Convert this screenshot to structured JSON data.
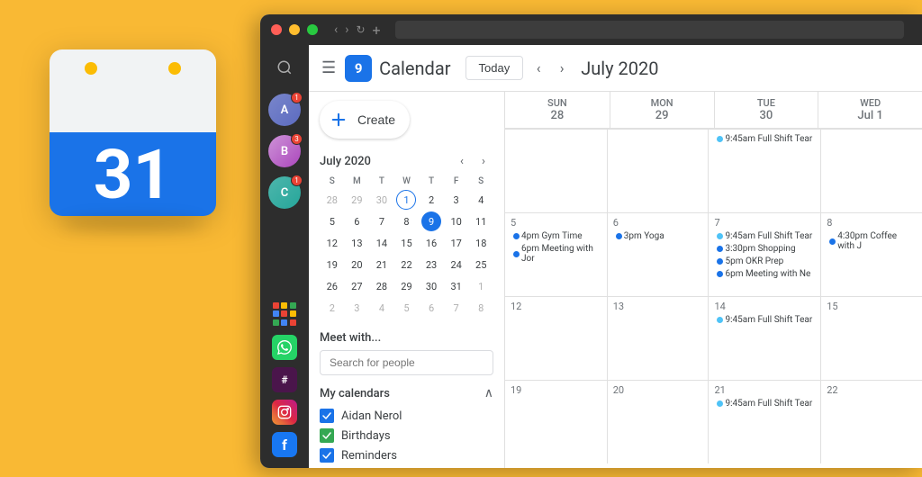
{
  "background": "#F9B934",
  "app_icon": {
    "number": "31",
    "dot1_color": "#FBBC04",
    "dot2_color": "#FBBC04"
  },
  "browser": {
    "traffic_lights": [
      "#FF5F57",
      "#FFBD2E",
      "#28C940"
    ]
  },
  "sidebar": {
    "search_icon": "🔍",
    "avatars": [
      {
        "color": "#5c6bc0",
        "initials": "A",
        "badge": "1"
      },
      {
        "color": "#ab47bc",
        "initials": "B",
        "badge": "3"
      },
      {
        "color": "#26a69a",
        "initials": "C",
        "badge": "1"
      }
    ],
    "app_icons": [
      "apps",
      "slack",
      "whatsapp",
      "instagram",
      "facebook"
    ]
  },
  "topbar": {
    "hamburger": "☰",
    "logo_number": "9",
    "title": "Calendar",
    "today_btn": "Today",
    "nav_prev": "‹",
    "nav_next": "›",
    "month_year": "July 2020"
  },
  "sidebar_content": {
    "create_btn": "Create",
    "mini_calendar": {
      "title": "July 2020",
      "nav_prev": "‹",
      "nav_next": "›",
      "weekdays": [
        "S",
        "M",
        "T",
        "W",
        "T",
        "F",
        "S"
      ],
      "weeks": [
        [
          "28",
          "29",
          "30",
          "1",
          "2",
          "3",
          "4"
        ],
        [
          "5",
          "6",
          "7",
          "8",
          "9",
          "10",
          "11"
        ],
        [
          "12",
          "13",
          "14",
          "15",
          "16",
          "17",
          "18"
        ],
        [
          "19",
          "20",
          "21",
          "22",
          "23",
          "24",
          "25"
        ],
        [
          "26",
          "27",
          "28",
          "29",
          "30",
          "31",
          "1"
        ],
        [
          "2",
          "3",
          "4",
          "5",
          "6",
          "7",
          "8"
        ]
      ],
      "other_month_dates": [
        "28",
        "29",
        "30",
        "1",
        "2",
        "3",
        "4",
        "26",
        "27",
        "28",
        "29",
        "30",
        "31",
        "1",
        "2",
        "3",
        "4",
        "5",
        "6",
        "7",
        "8"
      ],
      "today": "9",
      "first_day_index": 3
    },
    "meet_section": {
      "title": "Meet with...",
      "placeholder": "Search for people"
    },
    "my_calendars": {
      "title": "My calendars",
      "chevron": "∧",
      "items": [
        {
          "label": "Aidan Nerol",
          "color": "#1a73e8",
          "checked": true
        },
        {
          "label": "Birthdays",
          "color": "#34a853",
          "checked": true
        },
        {
          "label": "Reminders",
          "color": "#1a73e8",
          "checked": true
        }
      ]
    }
  },
  "calendar_grid": {
    "headers": [
      {
        "day": "SUN",
        "date": "28"
      },
      {
        "day": "MON",
        "date": "29"
      },
      {
        "day": "TUE",
        "date": "30"
      },
      {
        "day": "WED",
        "date": "Jul 1"
      }
    ],
    "rows": [
      {
        "cells": [
          {
            "date": "28",
            "events": []
          },
          {
            "date": "29",
            "events": []
          },
          {
            "date": "30",
            "events": [
              {
                "time": "9:45am",
                "title": "Full Shift Tear",
                "color": "light-blue"
              }
            ]
          },
          {
            "date": "Jul 1",
            "events": []
          }
        ]
      },
      {
        "cells": [
          {
            "date": "5",
            "events": [
              {
                "time": "4pm",
                "title": "Gym Time",
                "color": "blue"
              },
              {
                "time": "6pm",
                "title": "Meeting with Jor",
                "color": "blue"
              }
            ]
          },
          {
            "date": "6",
            "events": [
              {
                "time": "3pm",
                "title": "Yoga",
                "color": "blue"
              }
            ]
          },
          {
            "date": "7",
            "events": [
              {
                "time": "9:45am",
                "title": "Full Shift Tear",
                "color": "light-blue"
              },
              {
                "time": "3:30pm",
                "title": "Shopping",
                "color": "blue"
              },
              {
                "time": "5pm",
                "title": "OKR Prep",
                "color": "blue"
              },
              {
                "time": "6pm",
                "title": "Meeting with Ne",
                "color": "blue"
              }
            ]
          },
          {
            "date": "8",
            "events": [
              {
                "time": "4:30pm",
                "title": "Coffee with J",
                "color": "blue"
              }
            ]
          }
        ]
      },
      {
        "cells": [
          {
            "date": "12",
            "events": []
          },
          {
            "date": "13",
            "events": []
          },
          {
            "date": "14",
            "events": [
              {
                "time": "9:45am",
                "title": "Full Shift Tear",
                "color": "light-blue"
              }
            ]
          },
          {
            "date": "15",
            "events": []
          }
        ]
      },
      {
        "cells": [
          {
            "date": "19",
            "events": []
          },
          {
            "date": "20",
            "events": []
          },
          {
            "date": "21",
            "events": [
              {
                "time": "9:45am",
                "title": "Full Shift Tear",
                "color": "light-blue"
              }
            ]
          },
          {
            "date": "22",
            "events": []
          }
        ]
      }
    ]
  }
}
